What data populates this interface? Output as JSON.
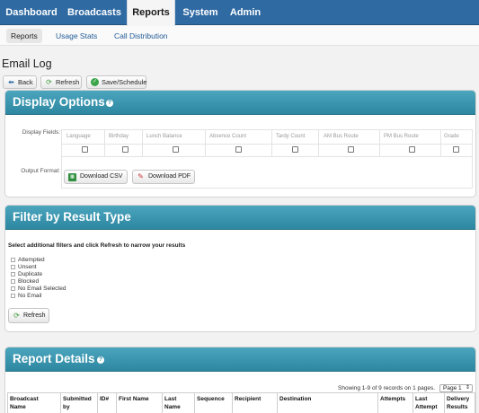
{
  "nav": {
    "tabs": [
      "Dashboard",
      "Broadcasts",
      "Reports",
      "System",
      "Admin"
    ],
    "active": "Reports"
  },
  "subnav": {
    "items": [
      "Reports",
      "Usage Stats",
      "Call Distribution"
    ],
    "active": "Reports"
  },
  "page": {
    "title": "Email Log"
  },
  "toolbar": {
    "back_label": "Back",
    "refresh_label": "Refresh",
    "save_schedule_label": "Save/Schedule"
  },
  "display_options": {
    "title": "Display Options",
    "display_fields_label": "Display Fields:",
    "fields": [
      "Language",
      "Birthday",
      "Lunch Balance",
      "Absence Count",
      "Tardy Count",
      "AM Bus Route",
      "PM Bus Route",
      "Grade"
    ],
    "output_format_label": "Output Format:",
    "download_csv_label": "Download CSV",
    "download_pdf_label": "Download PDF"
  },
  "filter": {
    "title": "Filter by Result Type",
    "instruction": "Select additional filters and click Refresh to narrow your results",
    "options": [
      "Attempted",
      "Unsent",
      "Duplicate",
      "Blocked",
      "No Email Selected",
      "No Email"
    ],
    "refresh_label": "Refresh"
  },
  "report": {
    "title": "Report Details",
    "records_text": "Showing 1-9 of 9 records on 1 pages.",
    "page_select_value": "Page 1",
    "columns": [
      [
        "Broadcast",
        "Name"
      ],
      [
        "Submitted",
        "by"
      ],
      [
        "ID#",
        ""
      ],
      [
        "First Name",
        ""
      ],
      [
        "Last",
        "Name"
      ],
      [
        "Sequence",
        ""
      ],
      [
        "Recipient",
        ""
      ],
      [
        "Destination",
        ""
      ],
      [
        "Attempts",
        ""
      ],
      [
        "Last",
        "Attempt"
      ],
      [
        "Delivery",
        "Results"
      ]
    ]
  },
  "colors": {
    "nav_bg": "#2f6aa3",
    "panel_header": "#3a96b0",
    "link": "#1f5a96"
  }
}
